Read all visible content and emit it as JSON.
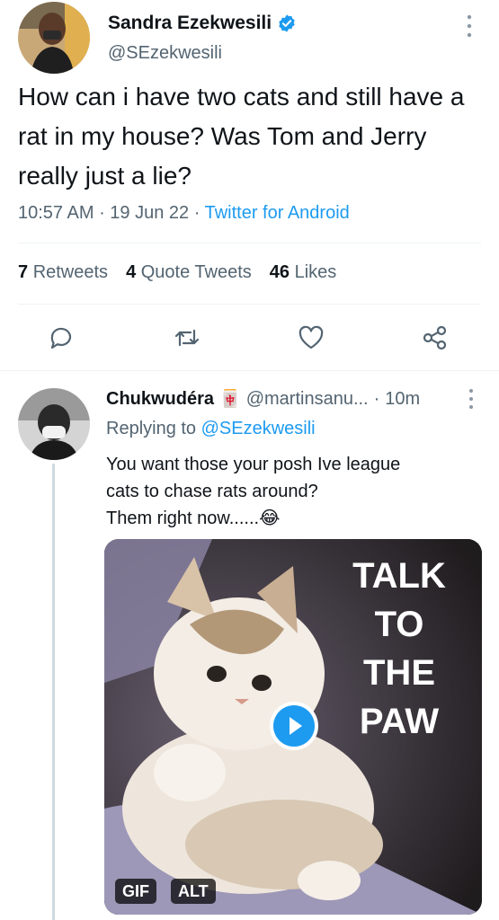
{
  "tweet": {
    "author_name": "Sandra Ezekwesili",
    "handle": "@SEzekwesili",
    "text": "How can i have two cats and still have a rat in my house? Was Tom and Jerry really just a lie?",
    "time": "10:57 AM",
    "date": "19 Jun 22",
    "source": "Twitter for Android",
    "stats": {
      "retweets_count": "7",
      "retweets_label": "Retweets",
      "quotes_count": "4",
      "quotes_label": "Quote Tweets",
      "likes_count": "46",
      "likes_label": "Likes"
    },
    "actions": [
      "reply-icon",
      "retweet-icon",
      "like-icon",
      "share-icon"
    ],
    "verified_color": "#1d9bf0"
  },
  "reply": {
    "author_name": "Chukwudéra",
    "name_emoji": "🀄",
    "handle": "@martinsanu...",
    "time": "10m",
    "replying_label": "Replying to",
    "replying_handle": "@SEzekwesili",
    "text_lines": [
      "You want those your posh Ive league",
      "cats to chase rats around?",
      "Them right now......😂"
    ],
    "media": {
      "overlay_lines": [
        "TALK",
        "TO",
        "THE",
        "PAW"
      ],
      "gif_badge": "GIF",
      "alt_badge": "ALT"
    }
  },
  "colors": {
    "accent": "#1d9bf0",
    "muted": "#536471",
    "text": "#0f1419",
    "divider": "#eff3f4"
  }
}
